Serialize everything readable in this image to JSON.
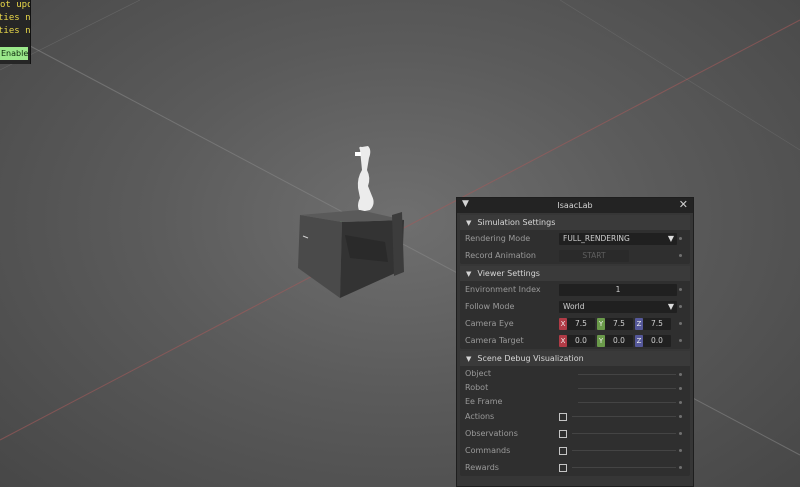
{
  "warning": {
    "lines": [
      "ot upda",
      "ties not c",
      "ties not c"
    ],
    "enabled_label": "Enabled"
  },
  "panel": {
    "title": "IsaacLab",
    "collapse_icon": "triangle-down-icon",
    "close_icon": "close-icon",
    "simulation": {
      "header": "Simulation Settings",
      "rendering_mode_label": "Rendering Mode",
      "rendering_mode_value": "FULL_RENDERING",
      "record_animation_label": "Record Animation",
      "start_label": "START"
    },
    "viewer": {
      "header": "Viewer Settings",
      "env_index_label": "Environment Index",
      "env_index_value": "1",
      "follow_mode_label": "Follow Mode",
      "follow_mode_value": "World",
      "camera_eye_label": "Camera Eye",
      "camera_eye": {
        "x": "7.5",
        "y": "7.5",
        "z": "7.5"
      },
      "camera_target_label": "Camera Target",
      "camera_target": {
        "x": "0.0",
        "y": "0.0",
        "z": "0.0"
      },
      "axis_labels": {
        "x": "X",
        "y": "Y",
        "z": "Z"
      }
    },
    "debug": {
      "header": "Scene Debug Visualization",
      "object_label": "Object",
      "robot_label": "Robot",
      "ee_frame_label": "Ee Frame",
      "actions_label": "Actions",
      "observations_label": "Observations",
      "commands_label": "Commands",
      "rewards_label": "Rewards"
    }
  },
  "colors": {
    "axis_x": "#b03b46",
    "axis_y": "#6a9a4a",
    "axis_z": "#55589a",
    "warning_text": "#e9d84a",
    "enabled_bg": "#9be88b"
  }
}
